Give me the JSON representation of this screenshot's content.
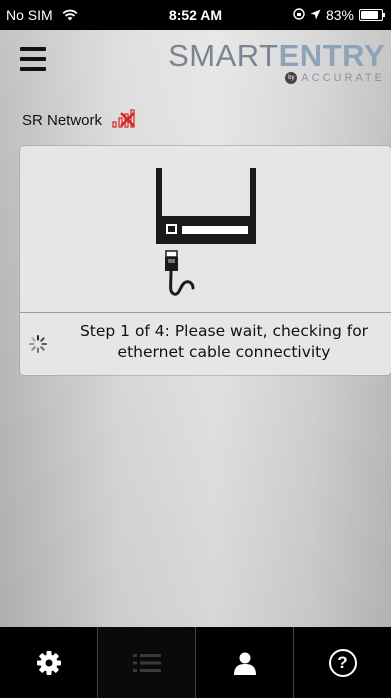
{
  "status_bar": {
    "carrier": "No SIM",
    "time": "8:52 AM",
    "battery": "83%",
    "battery_level": 0.83
  },
  "header": {
    "menu_icon": "hamburger-icon",
    "logo_smart": "SMART",
    "logo_entry": "ENTRY",
    "logo_by": "by",
    "logo_accurate": "ACCURATE"
  },
  "network": {
    "label": "SR Network",
    "icon": "no-signal-icon"
  },
  "card": {
    "illustration_icon": "ethernet-device-icon",
    "step_text": "Step 1 of 4: Please wait, checking for ethernet cable connectivity",
    "spinner_icon": "loading-spinner-icon"
  },
  "tab_bar": {
    "tabs": [
      {
        "icon": "gear-icon",
        "active": false
      },
      {
        "icon": "list-icon",
        "active": true
      },
      {
        "icon": "user-icon",
        "active": false
      },
      {
        "icon": "help-icon",
        "label": "?",
        "active": false
      }
    ]
  },
  "colors": {
    "logo_smart": "#7b8592",
    "logo_entry": "#8ea3b8",
    "signal_red": "#d7261e",
    "tab_bar_bg": "#000000"
  }
}
